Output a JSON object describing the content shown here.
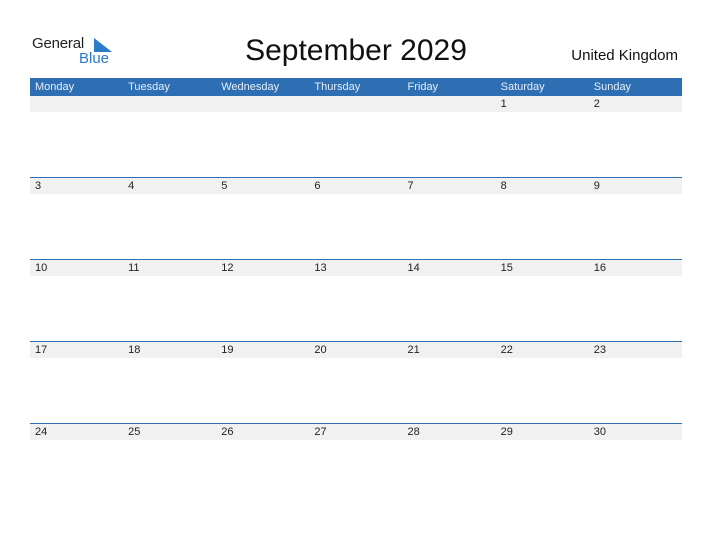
{
  "logo": {
    "line1": "General",
    "line2": "Blue"
  },
  "title": "September 2029",
  "country": "United Kingdom",
  "colors": {
    "accent": "#2e6fb3",
    "logo_blue": "#2a7bc8",
    "date_strip": "#f1f1f1"
  },
  "weekdays": [
    "Monday",
    "Tuesday",
    "Wednesday",
    "Thursday",
    "Friday",
    "Saturday",
    "Sunday"
  ],
  "weeks": [
    [
      "",
      "",
      "",
      "",
      "",
      "1",
      "2"
    ],
    [
      "3",
      "4",
      "5",
      "6",
      "7",
      "8",
      "9"
    ],
    [
      "10",
      "11",
      "12",
      "13",
      "14",
      "15",
      "16"
    ],
    [
      "17",
      "18",
      "19",
      "20",
      "21",
      "22",
      "23"
    ],
    [
      "24",
      "25",
      "26",
      "27",
      "28",
      "29",
      "30"
    ]
  ]
}
